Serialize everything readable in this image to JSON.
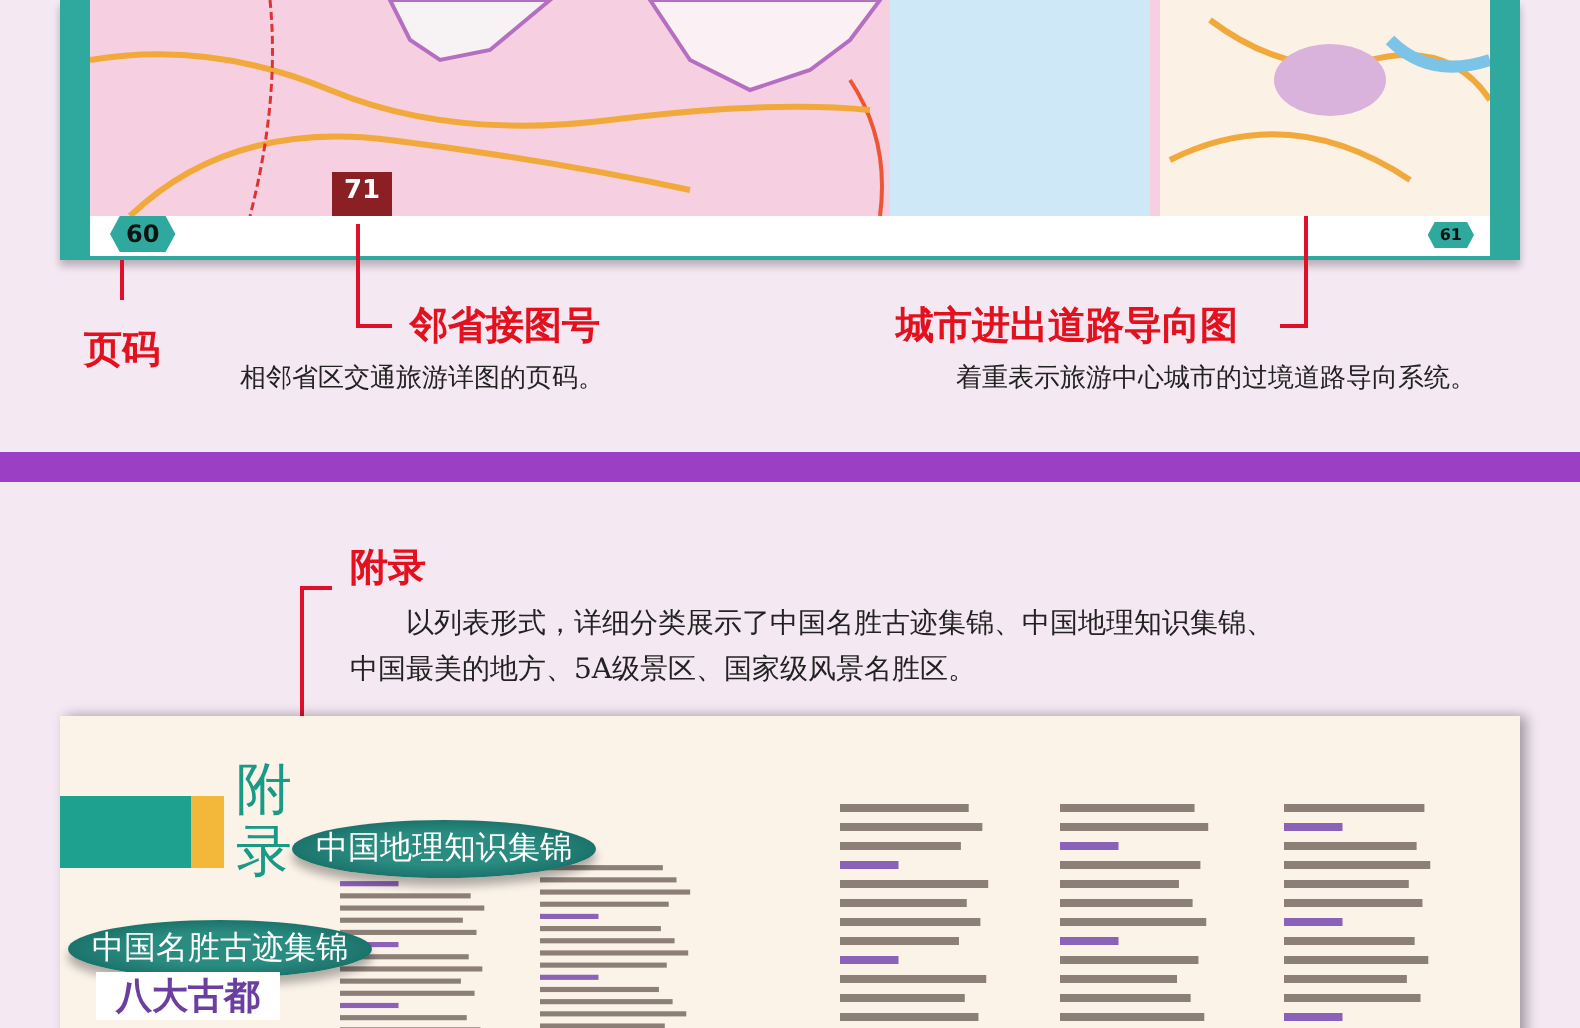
{
  "map_spread": {
    "left_page_number": "60",
    "adjacent_map_tab": "71",
    "right_page_number": "61"
  },
  "callouts": [
    {
      "kind": "page",
      "title": "页码"
    },
    {
      "kind": "adjacent",
      "title": "邻省接图号",
      "description": "相邻省区交通旅游详图的页码。"
    },
    {
      "kind": "city",
      "title": "城市进出道路导向图",
      "description": "着重表示旅游中心城市的过境道路导向系统。"
    }
  ],
  "appendix": {
    "title": "附录",
    "description": "以列表形式，详细分类展示了中国名胜古迹集锦、中国地理知识集锦、中国最美的地方、5A级景区、国家级风景名胜区。"
  },
  "appendix_page": {
    "heading": "附录",
    "banners": [
      "中国地理知识集锦",
      "中国名胜古迹集锦"
    ],
    "subheading": "八大古都"
  }
}
